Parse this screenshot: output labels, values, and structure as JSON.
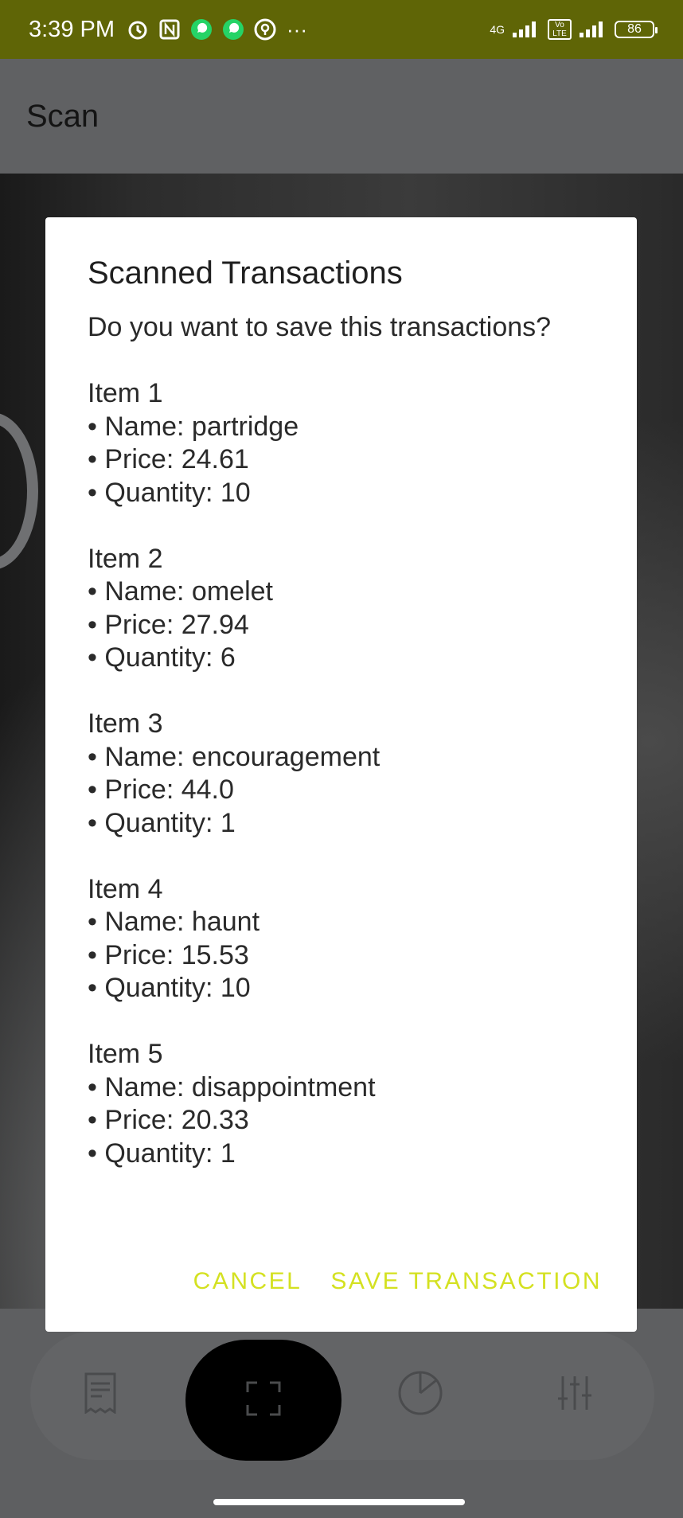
{
  "status_bar": {
    "time": "3:39 PM",
    "network_label": "4G",
    "volte_label": "Vo LTE",
    "battery": "86"
  },
  "app_bar": {
    "title": "Scan"
  },
  "dialog": {
    "title": "Scanned Transactions",
    "question": "Do you want to save this transactions?",
    "items": [
      {
        "header": "Item 1",
        "name": "• Name: partridge",
        "price": "• Price: 24.61",
        "quantity": "• Quantity: 10"
      },
      {
        "header": "Item 2",
        "name": "• Name: omelet",
        "price": "• Price: 27.94",
        "quantity": "• Quantity: 6"
      },
      {
        "header": "Item 3",
        "name": "• Name: encouragement",
        "price": "• Price: 44.0",
        "quantity": "• Quantity: 1"
      },
      {
        "header": "Item 4",
        "name": "• Name: haunt",
        "price": "• Price: 15.53",
        "quantity": "• Quantity: 10"
      },
      {
        "header": "Item 5",
        "name": "• Name: disappointment",
        "price": "• Price: 20.33",
        "quantity": "• Quantity: 1"
      }
    ],
    "cancel_label": "CANCEL",
    "save_label": "SAVE TRANSACTION"
  },
  "bottom_nav": {
    "items": [
      {
        "icon": "receipt-icon"
      },
      {
        "icon": "scan-icon"
      },
      {
        "icon": "pie-chart-icon"
      },
      {
        "icon": "sliders-icon"
      }
    ]
  },
  "colors": {
    "status_bar": "#5f6506",
    "accent_button": "#d4e121",
    "fab": "#000000"
  }
}
